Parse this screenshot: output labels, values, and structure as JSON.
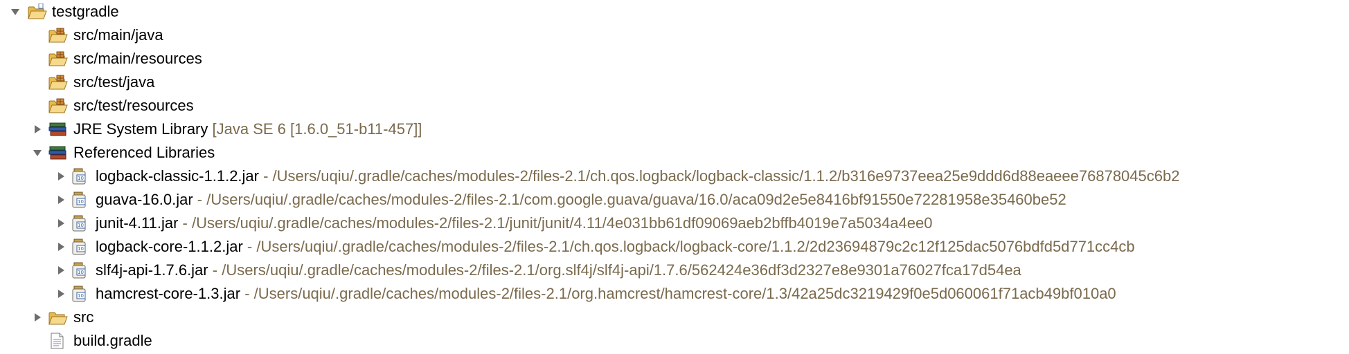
{
  "tree": {
    "project": {
      "label": "testgradle",
      "expanded": true,
      "icon": "project-folder-icon"
    },
    "source_folders": [
      {
        "label": "src/main/java",
        "icon": "package-folder-icon"
      },
      {
        "label": "src/main/resources",
        "icon": "package-folder-icon"
      },
      {
        "label": "src/test/java",
        "icon": "package-folder-icon"
      },
      {
        "label": "src/test/resources",
        "icon": "package-folder-icon"
      }
    ],
    "jre": {
      "label": "JRE System Library",
      "decoration": "[Java SE 6 [1.6.0_51-b11-457]]",
      "expanded": false,
      "icon": "library-icon"
    },
    "referenced": {
      "label": "Referenced Libraries",
      "expanded": true,
      "icon": "library-icon"
    },
    "jars": [
      {
        "name": "logback-classic-1.1.2.jar",
        "sep": " - ",
        "path": "/Users/uqiu/.gradle/caches/modules-2/files-2.1/ch.qos.logback/logback-classic/1.1.2/b316e9737eea25e9ddd6d88eaeee76878045c6b2"
      },
      {
        "name": "guava-16.0.jar",
        "sep": " - ",
        "path": "/Users/uqiu/.gradle/caches/modules-2/files-2.1/com.google.guava/guava/16.0/aca09d2e5e8416bf91550e72281958e35460be52"
      },
      {
        "name": "junit-4.11.jar",
        "sep": " - ",
        "path": "/Users/uqiu/.gradle/caches/modules-2/files-2.1/junit/junit/4.11/4e031bb61df09069aeb2bffb4019e7a5034a4ee0"
      },
      {
        "name": "logback-core-1.1.2.jar",
        "sep": " - ",
        "path": "/Users/uqiu/.gradle/caches/modules-2/files-2.1/ch.qos.logback/logback-core/1.1.2/2d23694879c2c12f125dac5076bdfd5d771cc4cb"
      },
      {
        "name": "slf4j-api-1.7.6.jar",
        "sep": " - ",
        "path": "/Users/uqiu/.gradle/caches/modules-2/files-2.1/org.slf4j/slf4j-api/1.7.6/562424e36df3d2327e8e9301a76027fca17d54ea"
      },
      {
        "name": "hamcrest-core-1.3.jar",
        "sep": " - ",
        "path": "/Users/uqiu/.gradle/caches/modules-2/files-2.1/org.hamcrest/hamcrest-core/1.3/42a25dc3219429f0e5d060061f71acb49bf010a0"
      }
    ],
    "src": {
      "label": "src",
      "expanded": false,
      "icon": "folder-icon"
    },
    "build_file": {
      "label": "build.gradle",
      "icon": "file-icon"
    }
  },
  "colors": {
    "decoration": "#7a6a4d",
    "folder": "#e8b94c",
    "arrow": "#6e6e6e"
  }
}
